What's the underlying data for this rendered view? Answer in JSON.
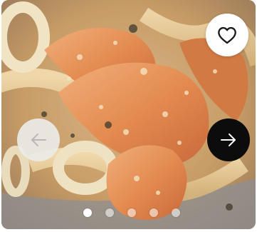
{
  "gallery": {
    "image_subject": "",
    "slide_count": 5,
    "active_slide": 1,
    "dots": [
      {
        "state": "active"
      },
      {
        "state": "inactive"
      },
      {
        "state": "inactive"
      },
      {
        "state": "inactive"
      },
      {
        "state": "inactive"
      }
    ],
    "icons": {
      "favorite": "heart-icon",
      "previous": "arrow-left-icon",
      "next": "arrow-right-icon"
    },
    "colors": {
      "favorite_button_bg": "#ffffff",
      "prev_button_bg": "#eceae8",
      "prev_arrow": "#b8b8b8",
      "next_button_bg": "#0c0c0c",
      "next_arrow": "#ffffff",
      "dot_active": "#ffffff",
      "dot_inactive": "#ffffff8c"
    }
  }
}
